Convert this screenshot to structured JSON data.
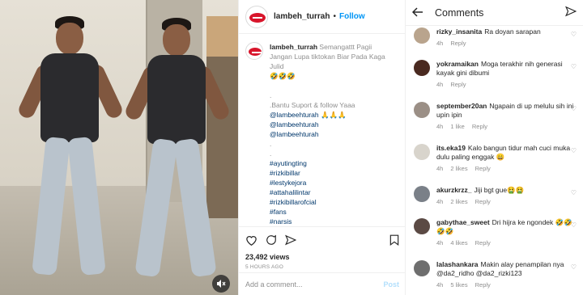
{
  "video": {
    "mute_icon": "speaker-muted-icon"
  },
  "post": {
    "username": "lambeh_turrah",
    "dot": "•",
    "follow_label": "Follow",
    "caption": {
      "username": "lambeh_turrah",
      "lines": [
        "Semangattt Pagii",
        "Jangan Lupa tiktokan Biar Pada Kaga",
        "Julid",
        "🤣🤣🤣"
      ],
      "dot1": ".",
      "support": ".Bantu Suport & follow Yaaa",
      "mention1": "@lambeehturah 🙏🙏🙏",
      "mention2": "@lambeehturah",
      "mention3": "@lambeehturah",
      "dot2": ".",
      "dot3": ".",
      "hashtags": [
        "#ayutingting",
        "#rizkibillar",
        "#lestykejora",
        "#attahalilintar",
        "#rizkibillarofcial",
        "#fans",
        "#narsis"
      ]
    },
    "views": "23,492 views",
    "time_ago": "5 HOURS AGO",
    "comment_placeholder": "Add a comment...",
    "post_button": "Post"
  },
  "comments_panel": {
    "title": "Comments",
    "items": [
      {
        "user": "rizky_insanita",
        "text": "Ra doyan sarapan",
        "time": "4h",
        "likes": "",
        "reply": "Reply",
        "avatar_color": "#b9a48d"
      },
      {
        "user": "yokramaikan",
        "text": "Moga terakhir nih generasi kayak gini dibumi",
        "time": "4h",
        "likes": "",
        "reply": "Reply",
        "avatar_color": "#4a2a20"
      },
      {
        "user": "september20an",
        "text": "Ngapain di up melulu sih ini upin ipin",
        "time": "4h",
        "likes": "1 like",
        "reply": "Reply",
        "avatar_color": "#9b8f86"
      },
      {
        "user": "its.eka19",
        "text": "Kalo bangun tidur mah cuci muka dulu paling enggak 😄",
        "time": "4h",
        "likes": "2 likes",
        "reply": "Reply",
        "avatar_color": "#d8d4cc"
      },
      {
        "user": "akurzkrzz_",
        "text": "Jiji bgt gue🤮🤮",
        "time": "4h",
        "likes": "2 likes",
        "reply": "Reply",
        "avatar_color": "#7a8088"
      },
      {
        "user": "gabythae_sweet",
        "text": "Dri hijra ke ngondek 🤣🤣🤣🤣",
        "time": "4h",
        "likes": "4 likes",
        "reply": "Reply",
        "avatar_color": "#5b4a44"
      },
      {
        "user": "lalashankara",
        "text": "Makin alay penampilan nya @da2_ridho @da2_rizki123",
        "time": "4h",
        "likes": "5 likes",
        "reply": "Reply",
        "avatar_color": "#6e6e6e"
      }
    ]
  }
}
